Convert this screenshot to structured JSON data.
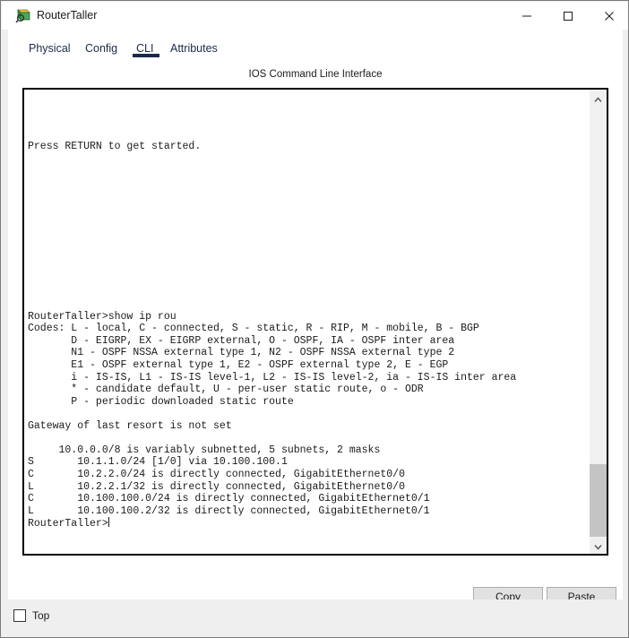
{
  "window": {
    "title": "RouterTaller",
    "icon": "router-app-icon",
    "controls": [
      {
        "name": "minimize",
        "glyph": "minimize-icon"
      },
      {
        "name": "maximize",
        "glyph": "maximize-icon"
      },
      {
        "name": "close",
        "glyph": "close-icon"
      }
    ]
  },
  "tabs": [
    {
      "id": "physical",
      "label": "Physical",
      "selected": false
    },
    {
      "id": "config",
      "label": "Config",
      "selected": false
    },
    {
      "id": "cli",
      "label": "CLI",
      "selected": true
    },
    {
      "id": "attributes",
      "label": "Attributes",
      "selected": false
    }
  ],
  "cli": {
    "header": "IOS Command Line Interface",
    "content": "\n\n\n\nPress RETURN to get started.\n\n\n\n\n\n\n\n\n\n\n\n\n\nRouterTaller>show ip rou\nCodes: L - local, C - connected, S - static, R - RIP, M - mobile, B - BGP\n       D - EIGRP, EX - EIGRP external, O - OSPF, IA - OSPF inter area\n       N1 - OSPF NSSA external type 1, N2 - OSPF NSSA external type 2\n       E1 - OSPF external type 1, E2 - OSPF external type 2, E - EGP\n       i - IS-IS, L1 - IS-IS level-1, L2 - IS-IS level-2, ia - IS-IS inter area\n       * - candidate default, U - per-user static route, o - ODR\n       P - periodic downloaded static route\n\nGateway of last resort is not set\n\n     10.0.0.0/8 is variably subnetted, 5 subnets, 2 masks\nS       10.1.1.0/24 [1/0] via 10.100.100.1\nC       10.2.2.0/24 is directly connected, GigabitEthernet0/0\nL       10.2.2.1/32 is directly connected, GigabitEthernet0/0\nC       10.100.100.0/24 is directly connected, GigabitEthernet0/1\nL       10.100.100.2/32 is directly connected, GigabitEthernet0/1\n",
    "prompt": "RouterTaller>",
    "scrollbar": {
      "up_arrow": "chevron-up-icon",
      "down_arrow": "chevron-down-icon"
    }
  },
  "buttons": {
    "copy": "Copy",
    "paste": "Paste"
  },
  "status": {
    "top_checkbox_label": "Top",
    "top_checkbox_checked": false
  },
  "colors": {
    "tab_accent": "#1b2a4a",
    "window_border": "#7a7a7a",
    "panel_bg": "#ffffff",
    "chrome_bg": "#efefef",
    "terminal_border": "#000000",
    "scrollbar_thumb": "#c4c4c4",
    "button_face": "#e1e1e1"
  }
}
